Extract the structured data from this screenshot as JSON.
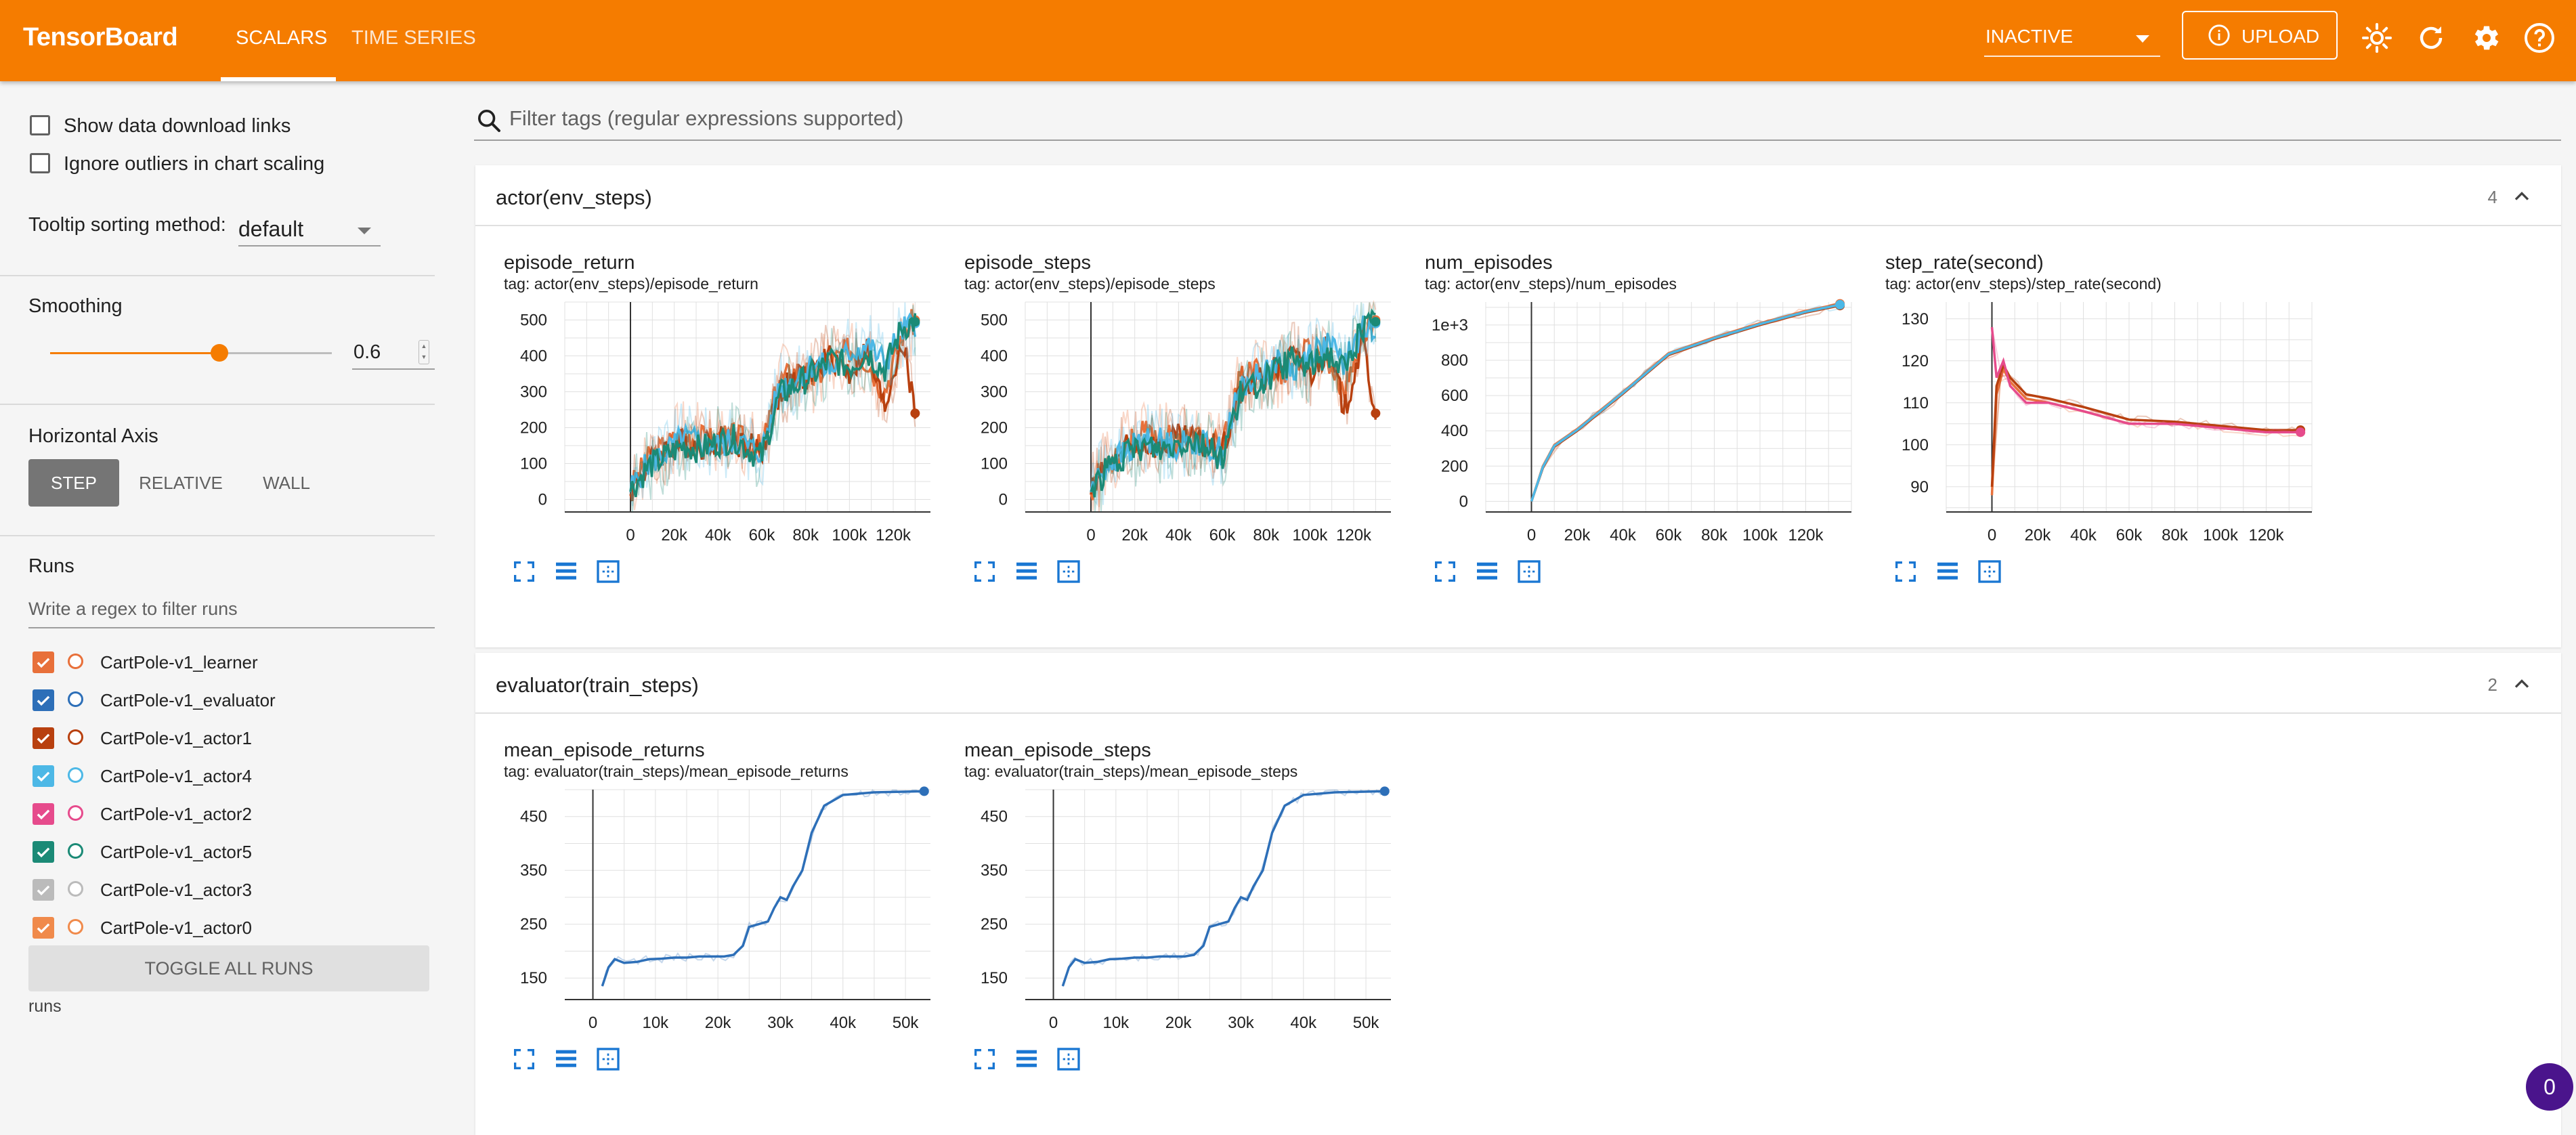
{
  "header": {
    "brand": "TensorBoard",
    "tabs": [
      "SCALARS",
      "TIME SERIES"
    ],
    "reload_status": "INACTIVE",
    "upload_label": "UPLOAD",
    "colors": {
      "bar": "#f57c00",
      "text": "#ffffff"
    },
    "icons": [
      "info-icon",
      "brightness-icon",
      "refresh-icon",
      "settings-icon",
      "help-icon"
    ]
  },
  "sidebar": {
    "options": [
      "Show data download links",
      "Ignore outliers in chart scaling"
    ],
    "tooltip_sort_label": "Tooltip sorting method:",
    "tooltip_sort_value": "default",
    "smoothing_label": "Smoothing",
    "smoothing_value": "0.6",
    "smoothing_level": 0.6,
    "horizontal_axis_label": "Horizontal Axis",
    "axis_options": [
      "STEP",
      "RELATIVE",
      "WALL"
    ],
    "axis_selected": "STEP",
    "runs_label": "Runs",
    "runs_filter_placeholder": "Write a regex to filter runs",
    "runs": [
      {
        "name": "CartPole-v1_learner",
        "color": "#e8703a",
        "checked": true
      },
      {
        "name": "CartPole-v1_evaluator",
        "color": "#2d6fb8",
        "checked": true
      },
      {
        "name": "CartPole-v1_actor1",
        "color": "#b8400f",
        "checked": true
      },
      {
        "name": "CartPole-v1_actor4",
        "color": "#4db8e6",
        "checked": true
      },
      {
        "name": "CartPole-v1_actor2",
        "color": "#e64b8c",
        "checked": true
      },
      {
        "name": "CartPole-v1_actor5",
        "color": "#1b8a76",
        "checked": true
      },
      {
        "name": "CartPole-v1_actor3",
        "color": "#bbbbbb",
        "checked": true
      },
      {
        "name": "CartPole-v1_actor0",
        "color": "#f08a4b",
        "checked": true
      }
    ],
    "toggle_label": "TOGGLE ALL RUNS",
    "footer": "runs"
  },
  "main": {
    "search_placeholder": "Filter tags (regular expressions supported)",
    "groups": [
      {
        "title": "actor(env_steps)",
        "count": "4",
        "charts": [
          {
            "title": "episode_return",
            "tag": "tag: actor(env_steps)/episode_return"
          },
          {
            "title": "episode_steps",
            "tag": "tag: actor(env_steps)/episode_steps"
          },
          {
            "title": "num_episodes",
            "tag": "tag: actor(env_steps)/num_episodes"
          },
          {
            "title": "step_rate(second)",
            "tag": "tag: actor(env_steps)/step_rate(second)"
          }
        ]
      },
      {
        "title": "evaluator(train_steps)",
        "count": "2",
        "charts": [
          {
            "title": "mean_episode_returns",
            "tag": "tag: evaluator(train_steps)/mean_episode_returns"
          },
          {
            "title": "mean_episode_steps",
            "tag": "tag: evaluator(train_steps)/mean_episode_steps"
          }
        ]
      }
    ],
    "notification_count": "0"
  },
  "chart_data": [
    {
      "type": "line",
      "title": "episode_return",
      "xlim": [
        -30000,
        137000
      ],
      "ylim": [
        -35000,
        550
      ],
      "ylim_display": [
        -35,
        550
      ],
      "xticks": [
        0,
        20000,
        40000,
        60000,
        80000,
        100000,
        120000
      ],
      "xtick_labels": [
        "0",
        "20k",
        "40k",
        "60k",
        "80k",
        "100k",
        "120k"
      ],
      "yticks": [
        0,
        100,
        200,
        300,
        400,
        500
      ],
      "ytick_labels": [
        "0",
        "100",
        "200",
        "300",
        "400",
        "500"
      ],
      "x": [
        0,
        8000,
        16000,
        24000,
        32000,
        40000,
        48000,
        56000,
        60000,
        68000,
        76000,
        84000,
        92000,
        100000,
        108000,
        116000,
        124000,
        130000
      ],
      "series": [
        {
          "name": "CartPole-v1_actor0",
          "color": "#e8703a",
          "values": [
            30,
            110,
            150,
            180,
            170,
            165,
            175,
            150,
            140,
            330,
            360,
            340,
            380,
            420,
            390,
            300,
            460,
            500
          ]
        },
        {
          "name": "CartPole-v1_actor1",
          "color": "#b8400f",
          "values": [
            25,
            95,
            140,
            160,
            150,
            170,
            160,
            145,
            130,
            300,
            330,
            360,
            400,
            350,
            420,
            250,
            450,
            240
          ]
        },
        {
          "name": "CartPole-v1_actor4",
          "color": "#4db8e6",
          "values": [
            28,
            100,
            130,
            170,
            160,
            150,
            165,
            140,
            135,
            310,
            340,
            380,
            360,
            410,
            430,
            380,
            470,
            490
          ]
        },
        {
          "name": "CartPole-v1_actor5",
          "color": "#1b8a76",
          "values": [
            26,
            90,
            120,
            150,
            140,
            160,
            170,
            130,
            120,
            290,
            320,
            350,
            390,
            370,
            410,
            360,
            480,
            495
          ]
        }
      ]
    },
    {
      "type": "line",
      "title": "episode_steps",
      "xlim": [
        -30000,
        137000
      ],
      "ylim": [
        -35,
        550
      ],
      "xticks": [
        0,
        20000,
        40000,
        60000,
        80000,
        100000,
        120000
      ],
      "xtick_labels": [
        "0",
        "20k",
        "40k",
        "60k",
        "80k",
        "100k",
        "120k"
      ],
      "yticks": [
        0,
        100,
        200,
        300,
        400,
        500
      ],
      "ytick_labels": [
        "0",
        "100",
        "200",
        "300",
        "400",
        "500"
      ],
      "x": [
        0,
        8000,
        16000,
        24000,
        32000,
        40000,
        48000,
        56000,
        60000,
        68000,
        76000,
        84000,
        92000,
        100000,
        108000,
        116000,
        124000,
        130000
      ],
      "series": [
        {
          "name": "CartPole-v1_actor0",
          "color": "#e8703a",
          "values": [
            30,
            110,
            150,
            180,
            170,
            165,
            175,
            150,
            140,
            330,
            360,
            340,
            380,
            420,
            390,
            300,
            460,
            500
          ]
        },
        {
          "name": "CartPole-v1_actor1",
          "color": "#b8400f",
          "values": [
            25,
            95,
            140,
            160,
            150,
            170,
            160,
            145,
            130,
            300,
            330,
            360,
            400,
            350,
            420,
            250,
            450,
            240
          ]
        },
        {
          "name": "CartPole-v1_actor4",
          "color": "#4db8e6",
          "values": [
            28,
            100,
            130,
            170,
            160,
            150,
            165,
            140,
            135,
            310,
            340,
            380,
            360,
            410,
            430,
            380,
            470,
            490
          ]
        },
        {
          "name": "CartPole-v1_actor5",
          "color": "#1b8a76",
          "values": [
            26,
            90,
            120,
            150,
            140,
            160,
            170,
            130,
            120,
            290,
            320,
            350,
            390,
            370,
            410,
            360,
            480,
            495
          ]
        }
      ]
    },
    {
      "type": "line",
      "title": "num_episodes",
      "xlim": [
        -20000,
        140000
      ],
      "ylim": [
        -60,
        1130
      ],
      "xticks": [
        0,
        20000,
        40000,
        60000,
        80000,
        100000,
        120000
      ],
      "xtick_labels": [
        "0",
        "20k",
        "40k",
        "60k",
        "80k",
        "100k",
        "120k"
      ],
      "yticks": [
        0,
        200,
        400,
        600,
        800,
        1000
      ],
      "ytick_labels": [
        "0",
        "200",
        "400",
        "600",
        "800",
        "1e+3"
      ],
      "x": [
        0,
        5000,
        10000,
        20000,
        40000,
        60000,
        80000,
        100000,
        120000,
        135000
      ],
      "series": [
        {
          "name": "CartPole-v1_actor0",
          "color": "#e8703a",
          "values": [
            0,
            200,
            320,
            410,
            620,
            840,
            930,
            1010,
            1080,
            1120
          ]
        },
        {
          "name": "CartPole-v1_actor1",
          "color": "#b8400f",
          "values": [
            0,
            190,
            310,
            400,
            610,
            830,
            920,
            1000,
            1070,
            1110
          ]
        },
        {
          "name": "CartPole-v1_actor4",
          "color": "#4db8e6",
          "values": [
            0,
            195,
            315,
            405,
            615,
            835,
            925,
            1005,
            1075,
            1115
          ]
        }
      ]
    },
    {
      "type": "line",
      "title": "step_rate(second)",
      "xlim": [
        -20000,
        140000
      ],
      "ylim": [
        84,
        134
      ],
      "xticks": [
        0,
        20000,
        40000,
        60000,
        80000,
        100000,
        120000
      ],
      "xtick_labels": [
        "0",
        "20k",
        "40k",
        "60k",
        "80k",
        "100k",
        "120k"
      ],
      "yticks": [
        90,
        100,
        110,
        120,
        130
      ],
      "ytick_labels": [
        "90",
        "100",
        "110",
        "120",
        "130"
      ],
      "x": [
        0,
        2000,
        5000,
        8000,
        15000,
        25000,
        40000,
        60000,
        80000,
        100000,
        120000,
        135000
      ],
      "series": [
        {
          "name": "CartPole-v1_actor0",
          "color": "#e8703a",
          "values": [
            88,
            112,
            118,
            115,
            111,
            110,
            108,
            105,
            105,
            104,
            103,
            103
          ]
        },
        {
          "name": "CartPole-v1_actor1",
          "color": "#b8400f",
          "values": [
            90,
            114,
            119,
            116,
            112,
            111,
            109,
            106,
            105.5,
            104.5,
            103.5,
            103.5
          ]
        },
        {
          "name": "CartPole-v1_actor2",
          "color": "#e64b8c",
          "values": [
            128,
            116,
            120,
            114,
            110,
            110,
            108,
            105,
            105,
            104,
            103,
            103
          ]
        }
      ]
    },
    {
      "type": "line",
      "title": "mean_episode_returns",
      "xlim": [
        -4500,
        54000
      ],
      "ylim": [
        110,
        500
      ],
      "xticks": [
        0,
        10000,
        20000,
        30000,
        40000,
        50000
      ],
      "xtick_labels": [
        "0",
        "10k",
        "20k",
        "30k",
        "40k",
        "50k"
      ],
      "yticks": [
        150,
        250,
        350,
        450
      ],
      "ytick_labels": [
        "150",
        "250",
        "350",
        "450"
      ],
      "x": [
        1500,
        2500,
        3500,
        5000,
        7000,
        9000,
        11000,
        13000,
        15000,
        17000,
        19000,
        21000,
        22500,
        24000,
        25000,
        26500,
        28000,
        29000,
        30000,
        31000,
        32000,
        33500,
        35000,
        37000,
        40000,
        45000,
        53000
      ],
      "series": [
        {
          "name": "CartPole-v1_evaluator",
          "color": "#2d6fb8",
          "values": [
            135,
            170,
            185,
            178,
            180,
            185,
            186,
            188,
            188,
            190,
            190,
            190,
            193,
            210,
            245,
            250,
            255,
            280,
            300,
            295,
            320,
            350,
            420,
            470,
            490,
            495,
            497
          ]
        }
      ]
    },
    {
      "type": "line",
      "title": "mean_episode_steps",
      "xlim": [
        -4500,
        54000
      ],
      "ylim": [
        110,
        500
      ],
      "xticks": [
        0,
        10000,
        20000,
        30000,
        40000,
        50000
      ],
      "xtick_labels": [
        "0",
        "10k",
        "20k",
        "30k",
        "40k",
        "50k"
      ],
      "yticks": [
        150,
        250,
        350,
        450
      ],
      "ytick_labels": [
        "150",
        "250",
        "350",
        "450"
      ],
      "x": [
        1500,
        2500,
        3500,
        5000,
        7000,
        9000,
        11000,
        13000,
        15000,
        17000,
        19000,
        21000,
        22500,
        24000,
        25000,
        26500,
        28000,
        29000,
        30000,
        31000,
        32000,
        33500,
        35000,
        37000,
        40000,
        45000,
        53000
      ],
      "series": [
        {
          "name": "CartPole-v1_evaluator",
          "color": "#2d6fb8",
          "values": [
            135,
            170,
            185,
            178,
            180,
            185,
            186,
            188,
            188,
            190,
            190,
            190,
            193,
            210,
            245,
            250,
            255,
            280,
            300,
            295,
            320,
            350,
            420,
            470,
            490,
            495,
            497
          ]
        }
      ]
    }
  ]
}
